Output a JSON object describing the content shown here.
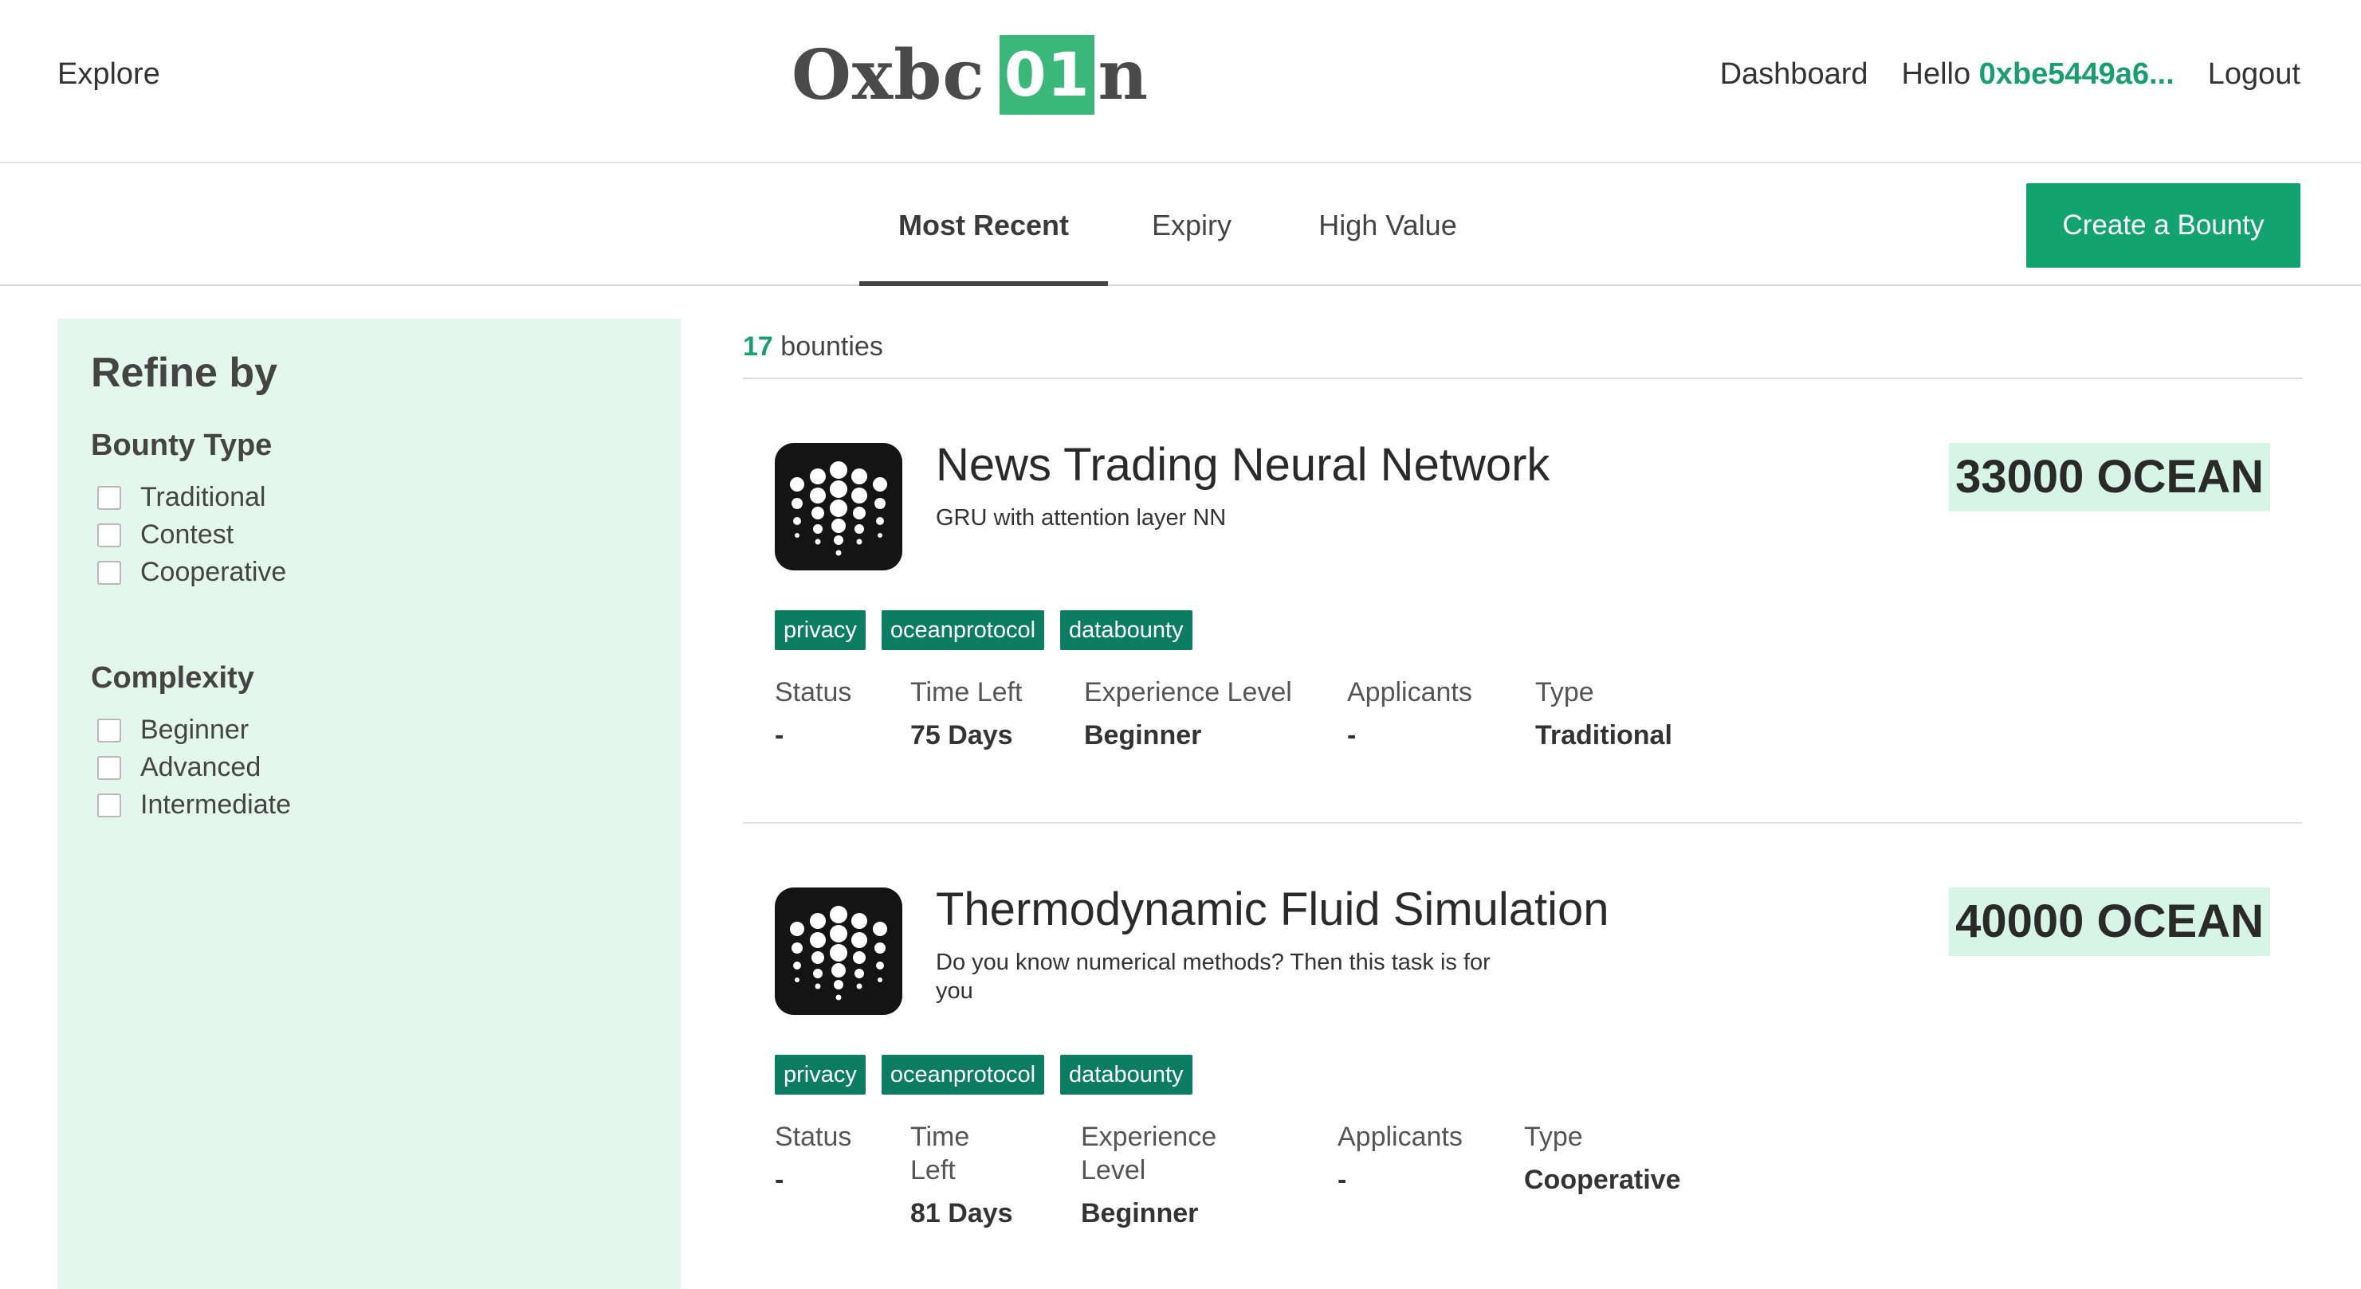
{
  "header": {
    "explore": "Explore",
    "logo_prefix": "Oxbc",
    "logo_badge": "01",
    "logo_suffix": "n",
    "dashboard": "Dashboard",
    "hello": "Hello",
    "address": "0xbe5449a6...",
    "logout": "Logout"
  },
  "tabs": {
    "most_recent": "Most Recent",
    "expiry": "Expiry",
    "high_value": "High Value",
    "active": "Most Recent"
  },
  "create_button": "Create a Bounty",
  "sidebar": {
    "title": "Refine by",
    "bounty_type": {
      "heading": "Bounty Type",
      "options": [
        "Traditional",
        "Contest",
        "Cooperative"
      ]
    },
    "complexity": {
      "heading": "Complexity",
      "options": [
        "Beginner",
        "Advanced",
        "Intermediate"
      ]
    }
  },
  "results": {
    "count": "17",
    "label": "bounties"
  },
  "meta_labels": {
    "status": "Status",
    "time_left": "Time Left",
    "experience": "Experience Level",
    "applicants": "Applicants",
    "type": "Type"
  },
  "bounties": [
    {
      "title": "News Trading Neural Network",
      "description": "GRU with attention layer NN",
      "reward": "33000 OCEAN",
      "tags": [
        "privacy",
        "oceanprotocol",
        "databounty"
      ],
      "status": "-",
      "time_left": "75 Days",
      "experience": "Beginner",
      "applicants": "-",
      "type": "Traditional"
    },
    {
      "title": "Thermodynamic Fluid Simulation",
      "description": "Do you know numerical methods? Then this task is for you",
      "reward": "40000 OCEAN",
      "tags": [
        "privacy",
        "oceanprotocol",
        "databounty"
      ],
      "status": "-",
      "time_left": "81 Days",
      "experience": "Beginner",
      "applicants": "-",
      "type": "Cooperative"
    }
  ],
  "colors": {
    "accent": "#13a371",
    "tag": "#0c7d62",
    "sidebar_bg": "#e3f7ef",
    "reward_bg": "#d6f5e7"
  },
  "icons": {
    "bounty_logo": "ocean-protocol-logo-icon",
    "checkbox": "checkbox-unchecked-icon"
  }
}
